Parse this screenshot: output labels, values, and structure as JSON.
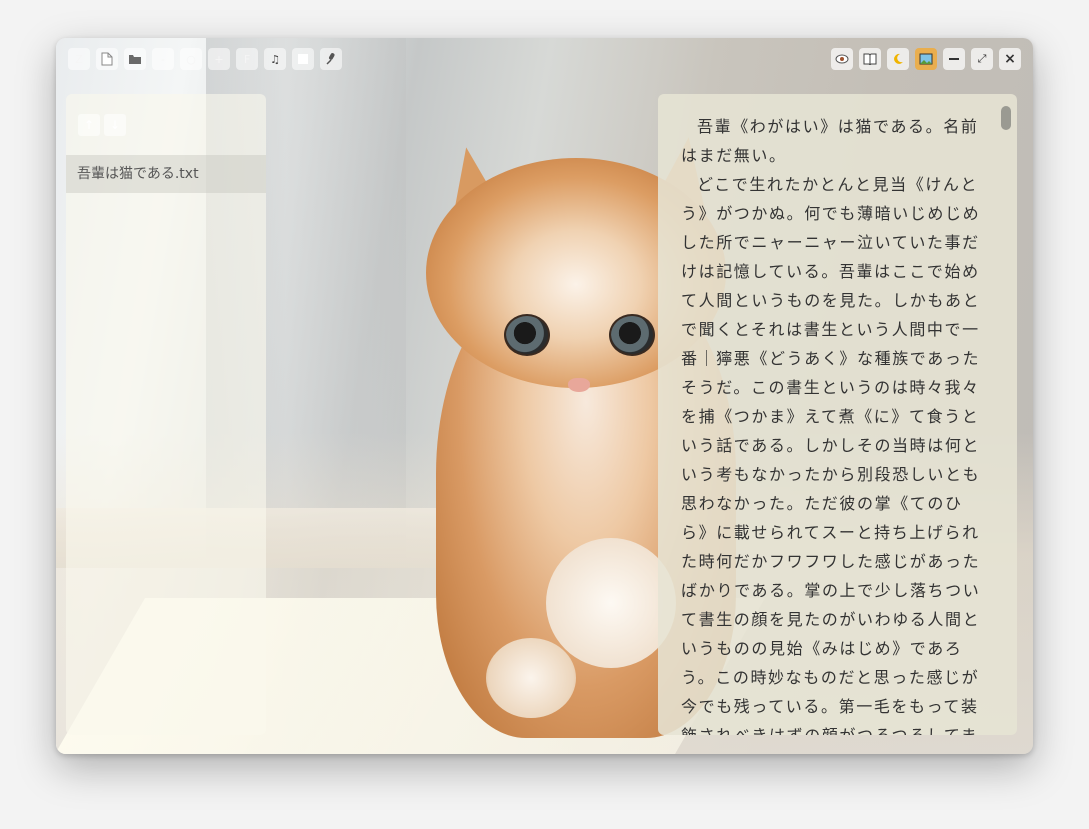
{
  "toolbar": {
    "buttons": [
      {
        "name": "z-button",
        "label": "Z"
      },
      {
        "name": "new-file-button",
        "label": "📄"
      },
      {
        "name": "open-folder-button",
        "label": "📂"
      },
      {
        "name": "font-smaller-button",
        "label": "-"
      },
      {
        "name": "font-reset-button",
        "label": "○"
      },
      {
        "name": "font-larger-button",
        "label": "+"
      },
      {
        "name": "font-button",
        "label": "F"
      },
      {
        "name": "music-button",
        "label": "♫"
      },
      {
        "name": "stop-button",
        "label": "■"
      },
      {
        "name": "microphone-button",
        "label": "🎤"
      }
    ]
  },
  "window_controls": {
    "eye": "👁",
    "book": "📖",
    "moon": "🌙",
    "image": "🖼",
    "minimize": "—",
    "maximize": "⤢",
    "close": "×"
  },
  "sidebar": {
    "up_label": "↑",
    "down_label": "↓",
    "files": [
      "吾輩は猫である.txt"
    ]
  },
  "reader": {
    "paragraphs": [
      "吾輩《わがはい》は猫である。名前はまだ無い。",
      "どこで生れたかとんと見当《けんとう》がつかぬ。何でも薄暗いじめじめした所でニャーニャー泣いていた事だけは記憶している。吾輩はここで始めて人間というものを見た。しかもあとで聞くとそれは書生という人間中で一番｜獰悪《どうあく》な種族であったそうだ。この書生というのは時々我々を捕《つかま》えて煮《に》て食うという話である。しかしその当時は何という考もなかったから別段恐しいとも思わなかった。ただ彼の掌《てのひら》に載せられてスーと持ち上げられた時何だかフワフワした感じがあったばかりである。掌の上で少し落ちついて書生の顔を見たのがいわゆる人間というものの見始《みはじめ》であろう。この時妙なものだと思った感じが今でも残っている。第一毛をもって装飾されべきはずの顔がつるつるしてまるで薬缶《やかん》だ。"
    ]
  }
}
